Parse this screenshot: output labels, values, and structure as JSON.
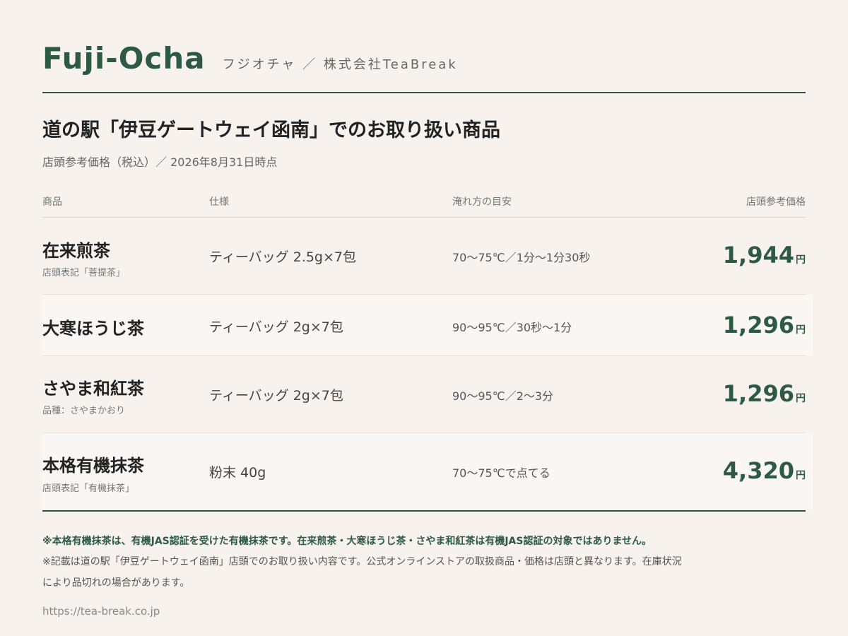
{
  "brand": {
    "name": "Fuji-Ocha",
    "sub": "フジオチャ ／ 株式会社TeaBreak"
  },
  "title": "道の駅「伊豆ゲートウェイ函南」でのお取り扱い商品",
  "subtitle": "店頭参考価格（税込）／ 2026年8月31日時点",
  "columns": {
    "product": "商品",
    "spec": "仕様",
    "brew": "淹れ方の目安",
    "price": "店頭参考価格"
  },
  "products": [
    {
      "name": "在来煎茶",
      "note": "店頭表記「菩提茶」",
      "spec": "ティーバッグ 2.5g×7包",
      "brew": "70〜75℃／1分〜1分30秒",
      "price": "1,944",
      "unit": "円"
    },
    {
      "name": "大寒ほうじ茶",
      "note": "",
      "spec": "ティーバッグ 2g×7包",
      "brew": "90〜95℃／30秒〜1分",
      "price": "1,296",
      "unit": "円"
    },
    {
      "name": "さやま和紅茶",
      "note": "品種：さやまかおり",
      "spec": "ティーバッグ 2g×7包",
      "brew": "90〜95℃／2〜3分",
      "price": "1,296",
      "unit": "円"
    },
    {
      "name": "本格有機抹茶",
      "note": "店頭表記「有機抹茶」",
      "spec": "粉末 40g",
      "brew": "70〜75℃で点てる",
      "price": "4,320",
      "unit": "円"
    }
  ],
  "notes": {
    "bold": "※本格有機抹茶は、有機JAS認証を受けた有機抹茶です。在来煎茶・大寒ほうじ茶・さやま和紅茶は有機JAS認証の対象ではありません。",
    "line1": "※記載は道の駅「伊豆ゲートウェイ函南」店頭でのお取り扱い内容です。公式オンラインストアの取扱商品・価格は店頭と異なります。在庫状況",
    "line2": "により品切れの場合があります。"
  },
  "url": "https://tea-break.co.jp",
  "colors": {
    "accent": "#2e5a45",
    "background": "#f7f2ee"
  }
}
